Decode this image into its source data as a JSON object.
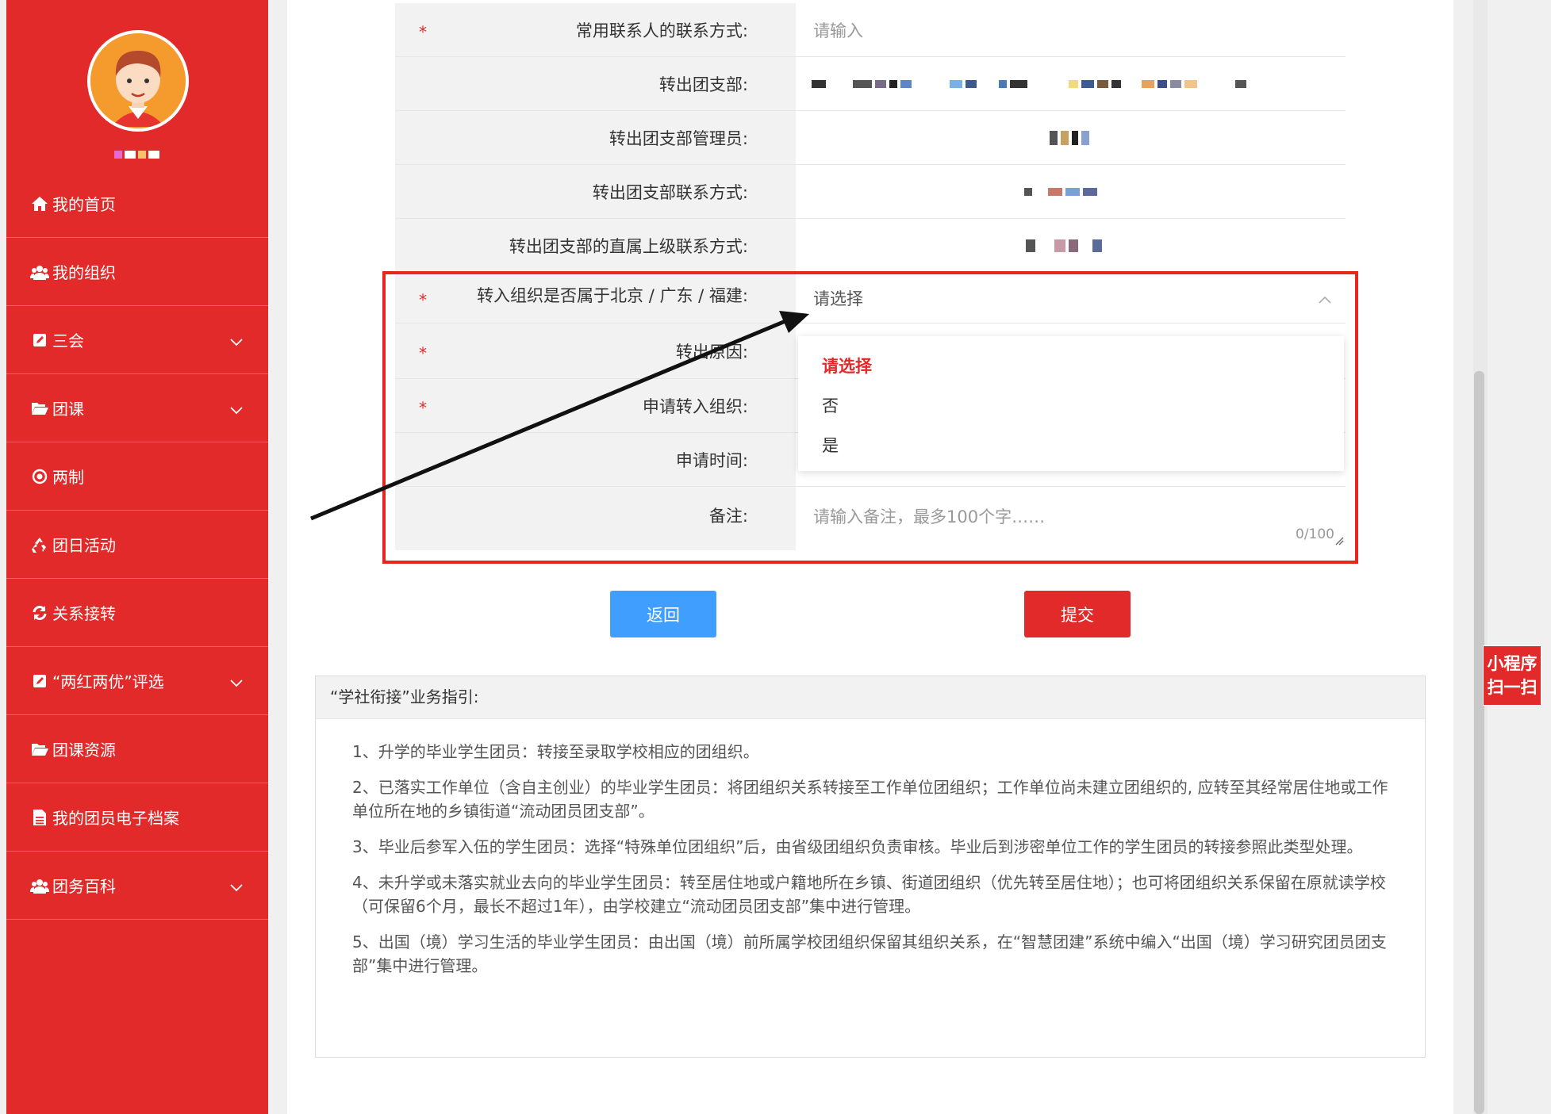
{
  "sidebar": {
    "items": [
      {
        "label": "我的首页",
        "icon": "home-icon",
        "expandable": false
      },
      {
        "label": "我的组织",
        "icon": "users-icon",
        "expandable": false
      },
      {
        "label": "三会",
        "icon": "edit-icon",
        "expandable": true
      },
      {
        "label": "团课",
        "icon": "folder-open-icon",
        "expandable": true
      },
      {
        "label": "两制",
        "icon": "dot-circle-icon",
        "expandable": false
      },
      {
        "label": "团日活动",
        "icon": "recycle-icon",
        "expandable": false
      },
      {
        "label": "关系接转",
        "icon": "refresh-icon",
        "expandable": false
      },
      {
        "label": "“两红两优”评选",
        "icon": "edit-icon",
        "expandable": true
      },
      {
        "label": "团课资源",
        "icon": "folder-open-icon",
        "expandable": false
      },
      {
        "label": "我的团员电子档案",
        "icon": "file-icon",
        "expandable": false
      },
      {
        "label": "团务百科",
        "icon": "users-icon",
        "expandable": true
      }
    ]
  },
  "form": {
    "rows": [
      {
        "label": "常用联系人的联系方式:",
        "required": true,
        "placeholder": "请输入"
      },
      {
        "label": "转出团支部:",
        "required": false
      },
      {
        "label": "转出团支部管理员:",
        "required": false
      },
      {
        "label": "转出团支部联系方式:",
        "required": false
      },
      {
        "label": "转出团支部的直属上级联系方式:",
        "required": false
      },
      {
        "label": "转入组织是否属于北京 / 广东 / 福建:",
        "required": true,
        "placeholder": "请选择"
      },
      {
        "label": "转出原因:",
        "required": true
      },
      {
        "label": "申请转入组织:",
        "required": true
      },
      {
        "label": "申请时间:",
        "required": false
      },
      {
        "label": "备注:",
        "required": false,
        "placeholder": "请输入备注，最多100个字……",
        "counter": "0/100"
      }
    ],
    "dropdown_options": [
      "请选择",
      "否",
      "是"
    ],
    "dropdown_selected_index": 0
  },
  "buttons": {
    "back": "返回",
    "submit": "提交"
  },
  "guide": {
    "title": "“学社衔接”业务指引:",
    "items": [
      "1、升学的毕业学生团员：转接至录取学校相应的团组织。",
      "2、已落实工作单位（含自主创业）的毕业学生团员：将团组织关系转接至工作单位团组织；工作单位尚未建立团组织的, 应转至其经常居住地或工作单位所在地的乡镇街道“流动团员团支部”。",
      "3、毕业后参军入伍的学生团员：选择“特殊单位团组织”后，由省级团组织负责审核。毕业后到涉密单位工作的学生团员的转接参照此类型处理。",
      "4、未升学或未落实就业去向的毕业学生团员：转至居住地或户籍地所在乡镇、街道团组织（优先转至居住地）；也可将团组织关系保留在原就读学校（可保留6个月，最长不超过1年），由学校建立“流动团员团支部”集中进行管理。",
      "5、出国（境）学习生活的毕业学生团员：由出国（境）前所属学校团组织保留其组织关系，在“智慧团建”系统中编入“出国（境）学习研究团员团支部”集中进行管理。"
    ]
  },
  "mini_program": {
    "line1": "小程序",
    "line2": "扫一扫"
  },
  "colors": {
    "brand_red": "#e12a29",
    "back_blue": "#409eff",
    "highlight": "#e8251f"
  }
}
